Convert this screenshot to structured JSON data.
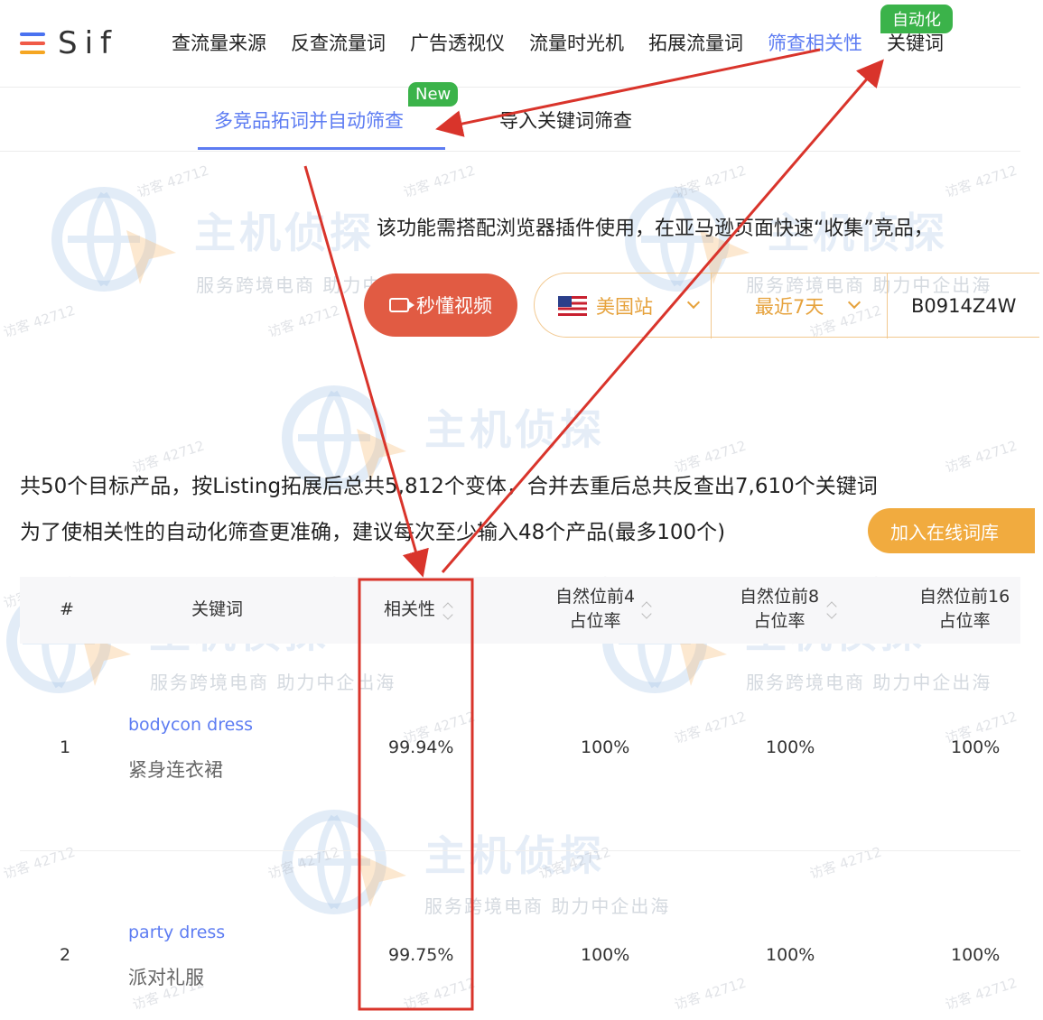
{
  "brand": {
    "name": "Sif"
  },
  "nav": {
    "items": [
      "查流量来源",
      "反查流量词",
      "广告透视仪",
      "流量时光机",
      "拓展流量词",
      "筛查相关性",
      "关键词"
    ],
    "active_index": 5,
    "badge": "自动化"
  },
  "subtabs": {
    "items": [
      "多竞品拓词并自动筛查",
      "导入关键词筛查"
    ],
    "active_index": 0,
    "badge": "New"
  },
  "info": {
    "text": "该功能需搭配浏览器插件使用，在亚马逊页面快速“收集”竞品，"
  },
  "video_button": {
    "label": "秒懂视频"
  },
  "filters": {
    "site": "美国站",
    "period": "最近7天",
    "asin": "B0914Z4W"
  },
  "summary": {
    "line1": "共50个目标产品，按Listing拓展后总共5,812个变体，合并去重后总共反查出7,610个关键词",
    "line2": "为了使相关性的自动化筛查更准确，建议每次至少输入48个产品(最多100个)",
    "add_button": "加入在线词库"
  },
  "table": {
    "headers": {
      "index": "#",
      "keyword": "关键词",
      "relevance": "相关性",
      "top4_line1": "自然位前4",
      "top4_line2": "占位率",
      "top8_line1": "自然位前8",
      "top8_line2": "占位率",
      "top16_line1": "自然位前16",
      "top16_line2": "占位率"
    },
    "rows": [
      {
        "index": "1",
        "keyword_en": "bodycon dress",
        "keyword_cn": "紧身连衣裙",
        "relevance": "99.94%",
        "top4": "100%",
        "top8": "100%",
        "top16": "100%"
      },
      {
        "index": "2",
        "keyword_en": "party dress",
        "keyword_cn": "派对礼服",
        "relevance": "99.75%",
        "top4": "100%",
        "top8": "100%",
        "top16": "100%"
      }
    ]
  },
  "watermark": {
    "brand": "主机侦探",
    "slogan": "服务跨境电商 助力中企出海",
    "visitor": "访客 42712"
  },
  "colors": {
    "accent": "#5d7cf2",
    "badge_green": "#3bb34a",
    "video_red": "#e15b43",
    "filter_orange": "#e6a23c",
    "library_orange": "#f1ab3f",
    "annotation_red": "#d9342b"
  }
}
